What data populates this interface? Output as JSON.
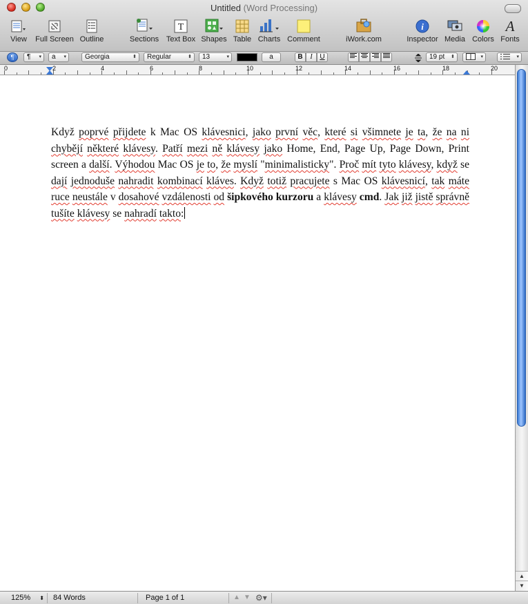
{
  "window": {
    "title": "Untitled",
    "subtitle": "(Word Processing)"
  },
  "toolbar": {
    "items": [
      {
        "label": "View",
        "icon": "view-icon"
      },
      {
        "label": "Full Screen",
        "icon": "full-screen-icon"
      },
      {
        "label": "Outline",
        "icon": "outline-icon"
      },
      {
        "label": "Sections",
        "icon": "sections-icon"
      },
      {
        "label": "Text Box",
        "icon": "text-box-icon"
      },
      {
        "label": "Shapes",
        "icon": "shapes-icon"
      },
      {
        "label": "Table",
        "icon": "table-icon"
      },
      {
        "label": "Charts",
        "icon": "charts-icon"
      },
      {
        "label": "Comment",
        "icon": "comment-icon"
      },
      {
        "label": "iWork.com",
        "icon": "iwork-icon"
      },
      {
        "label": "Inspector",
        "icon": "inspector-icon"
      },
      {
        "label": "Media",
        "icon": "media-icon"
      },
      {
        "label": "Colors",
        "icon": "colors-icon"
      },
      {
        "label": "Fonts",
        "icon": "fonts-icon"
      }
    ]
  },
  "format_bar": {
    "paragraph_style": "¶",
    "character_style": "a",
    "font_family": "Georgia",
    "font_typeface": "Regular",
    "font_size": "13",
    "text_bg_label": "a",
    "bold_label": "B",
    "italic_label": "I",
    "underline_label": "U",
    "line_spacing": "19 pt"
  },
  "ruler": {
    "numbers": [
      "0",
      "2",
      "4",
      "6",
      "8",
      "10",
      "12",
      "14",
      "16",
      "18",
      "20"
    ]
  },
  "document": {
    "segments": [
      {
        "text": "Když ",
        "sq": false,
        "b": false
      },
      {
        "text": "poprvé",
        "sq": true,
        "b": false
      },
      {
        "text": " ",
        "sq": false,
        "b": false
      },
      {
        "text": "přijdete",
        "sq": true,
        "b": false
      },
      {
        "text": " k Mac OS ",
        "sq": false,
        "b": false
      },
      {
        "text": "klávesnici",
        "sq": true,
        "b": false
      },
      {
        "text": ", ",
        "sq": false,
        "b": false
      },
      {
        "text": "jako",
        "sq": true,
        "b": false
      },
      {
        "text": " ",
        "sq": false,
        "b": false
      },
      {
        "text": "první",
        "sq": true,
        "b": false
      },
      {
        "text": " ",
        "sq": false,
        "b": false
      },
      {
        "text": "věc",
        "sq": true,
        "b": false
      },
      {
        "text": ", ",
        "sq": false,
        "b": false
      },
      {
        "text": "které",
        "sq": true,
        "b": false
      },
      {
        "text": " ",
        "sq": false,
        "b": false
      },
      {
        "text": "si",
        "sq": true,
        "b": false
      },
      {
        "text": " ",
        "sq": false,
        "b": false
      },
      {
        "text": "všimnete",
        "sq": true,
        "b": false
      },
      {
        "text": " ",
        "sq": false,
        "b": false
      },
      {
        "text": "je",
        "sq": true,
        "b": false
      },
      {
        "text": " ",
        "sq": false,
        "b": false
      },
      {
        "text": "ta",
        "sq": true,
        "b": false
      },
      {
        "text": ", ",
        "sq": false,
        "b": false
      },
      {
        "text": "že",
        "sq": true,
        "b": false
      },
      {
        "text": " ",
        "sq": false,
        "b": false
      },
      {
        "text": "na",
        "sq": true,
        "b": false
      },
      {
        "text": " ",
        "sq": false,
        "b": false
      },
      {
        "text": "ni",
        "sq": true,
        "b": false
      },
      {
        "text": " ",
        "sq": false,
        "b": false
      },
      {
        "text": "chybějí",
        "sq": true,
        "b": false
      },
      {
        "text": " ",
        "sq": false,
        "b": false
      },
      {
        "text": "některé",
        "sq": true,
        "b": false
      },
      {
        "text": " ",
        "sq": false,
        "b": false
      },
      {
        "text": "klávesy",
        "sq": true,
        "b": false
      },
      {
        "text": ". ",
        "sq": false,
        "b": false
      },
      {
        "text": "Patří",
        "sq": true,
        "b": false
      },
      {
        "text": " ",
        "sq": false,
        "b": false
      },
      {
        "text": "mezi",
        "sq": true,
        "b": false
      },
      {
        "text": " ",
        "sq": false,
        "b": false
      },
      {
        "text": "ně",
        "sq": true,
        "b": false
      },
      {
        "text": " ",
        "sq": false,
        "b": false
      },
      {
        "text": "klávesy",
        "sq": true,
        "b": false
      },
      {
        "text": " ",
        "sq": false,
        "b": false
      },
      {
        "text": "jako",
        "sq": true,
        "b": false
      },
      {
        "text": " Home, End, Page Up, Page Down, Print screen a ",
        "sq": false,
        "b": false
      },
      {
        "text": "další",
        "sq": true,
        "b": false
      },
      {
        "text": ". ",
        "sq": false,
        "b": false
      },
      {
        "text": "Výhodou",
        "sq": true,
        "b": false
      },
      {
        "text": " Mac OS ",
        "sq": false,
        "b": false
      },
      {
        "text": "je",
        "sq": true,
        "b": false
      },
      {
        "text": " ",
        "sq": false,
        "b": false
      },
      {
        "text": "to",
        "sq": true,
        "b": false
      },
      {
        "text": ", ",
        "sq": false,
        "b": false
      },
      {
        "text": "že",
        "sq": true,
        "b": false
      },
      {
        "text": " ",
        "sq": false,
        "b": false
      },
      {
        "text": "myslí",
        "sq": true,
        "b": false
      },
      {
        "text": " \"",
        "sq": false,
        "b": false
      },
      {
        "text": "minimalisticky",
        "sq": true,
        "b": false
      },
      {
        "text": "\". ",
        "sq": false,
        "b": false
      },
      {
        "text": "Proč",
        "sq": true,
        "b": false
      },
      {
        "text": " ",
        "sq": false,
        "b": false
      },
      {
        "text": "mít",
        "sq": true,
        "b": false
      },
      {
        "text": " ",
        "sq": false,
        "b": false
      },
      {
        "text": "tyto",
        "sq": true,
        "b": false
      },
      {
        "text": " ",
        "sq": false,
        "b": false
      },
      {
        "text": "klávesy",
        "sq": true,
        "b": false
      },
      {
        "text": ", ",
        "sq": false,
        "b": false
      },
      {
        "text": "když",
        "sq": true,
        "b": false
      },
      {
        "text": " se ",
        "sq": false,
        "b": false
      },
      {
        "text": "dají",
        "sq": true,
        "b": false
      },
      {
        "text": " ",
        "sq": false,
        "b": false
      },
      {
        "text": "jednoduše",
        "sq": true,
        "b": false
      },
      {
        "text": " ",
        "sq": false,
        "b": false
      },
      {
        "text": "nahradit",
        "sq": true,
        "b": false
      },
      {
        "text": " ",
        "sq": false,
        "b": false
      },
      {
        "text": "kombinací",
        "sq": true,
        "b": false
      },
      {
        "text": " ",
        "sq": false,
        "b": false
      },
      {
        "text": "kláves",
        "sq": true,
        "b": false
      },
      {
        "text": ". ",
        "sq": false,
        "b": false
      },
      {
        "text": "Když",
        "sq": true,
        "b": false
      },
      {
        "text": " ",
        "sq": false,
        "b": false
      },
      {
        "text": "totiž",
        "sq": true,
        "b": false
      },
      {
        "text": " ",
        "sq": false,
        "b": false
      },
      {
        "text": "pracujete",
        "sq": true,
        "b": false
      },
      {
        "text": " s Mac OS ",
        "sq": false,
        "b": false
      },
      {
        "text": "klávesnicí",
        "sq": true,
        "b": false
      },
      {
        "text": ", ",
        "sq": false,
        "b": false
      },
      {
        "text": "tak",
        "sq": true,
        "b": false
      },
      {
        "text": " ",
        "sq": false,
        "b": false
      },
      {
        "text": "máte",
        "sq": true,
        "b": false
      },
      {
        "text": " ",
        "sq": false,
        "b": false
      },
      {
        "text": "ruce",
        "sq": true,
        "b": false
      },
      {
        "text": " ",
        "sq": false,
        "b": false
      },
      {
        "text": "neustále",
        "sq": true,
        "b": false
      },
      {
        "text": " v ",
        "sq": false,
        "b": false
      },
      {
        "text": "dosahové",
        "sq": true,
        "b": false
      },
      {
        "text": " ",
        "sq": false,
        "b": false
      },
      {
        "text": "vzdálenosti",
        "sq": true,
        "b": false
      },
      {
        "text": " ",
        "sq": false,
        "b": false
      },
      {
        "text": "od",
        "sq": true,
        "b": false
      },
      {
        "text": " ",
        "sq": false,
        "b": false
      },
      {
        "text": "šipkového kurzoru",
        "sq": false,
        "b": true
      },
      {
        "text": " a ",
        "sq": false,
        "b": false
      },
      {
        "text": "klávesy",
        "sq": true,
        "b": false
      },
      {
        "text": " ",
        "sq": false,
        "b": false
      },
      {
        "text": "cmd",
        "sq": false,
        "b": true
      },
      {
        "text": ". ",
        "sq": false,
        "b": false
      },
      {
        "text": "Jak",
        "sq": true,
        "b": false
      },
      {
        "text": " ",
        "sq": false,
        "b": false
      },
      {
        "text": "již",
        "sq": true,
        "b": false
      },
      {
        "text": " ",
        "sq": false,
        "b": false
      },
      {
        "text": "jistě",
        "sq": true,
        "b": false
      },
      {
        "text": " ",
        "sq": false,
        "b": false
      },
      {
        "text": "správně",
        "sq": true,
        "b": false
      },
      {
        "text": " ",
        "sq": false,
        "b": false
      },
      {
        "text": "tušíte",
        "sq": true,
        "b": false
      },
      {
        "text": " ",
        "sq": false,
        "b": false
      },
      {
        "text": "klávesy",
        "sq": true,
        "b": false
      },
      {
        "text": " se ",
        "sq": false,
        "b": false
      },
      {
        "text": "nahradí",
        "sq": true,
        "b": false
      },
      {
        "text": " ",
        "sq": false,
        "b": false
      },
      {
        "text": "takto",
        "sq": true,
        "b": false
      },
      {
        "text": ":",
        "sq": false,
        "b": false
      }
    ]
  },
  "status": {
    "zoom": "125%",
    "word_count": "84 Words",
    "page": "Page 1 of 1"
  },
  "colors": {
    "scroll_thumb": "#3a7bd5",
    "spell_squiggle": "#e23b2f",
    "text_color_swatch": "#000000"
  }
}
